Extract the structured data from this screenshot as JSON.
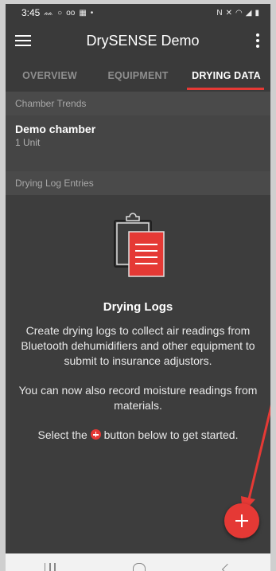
{
  "status_bar": {
    "time": "3:45",
    "left_icons": [
      "location-icon",
      "circle-icon",
      "voicemail-icon",
      "sim-icon",
      "dot-icon"
    ],
    "right_icons": [
      "nfc-icon",
      "mute-icon",
      "wifi-icon",
      "signal-icon",
      "battery-icon"
    ]
  },
  "app_bar": {
    "title": "DrySENSE Demo"
  },
  "tabs": [
    {
      "label": "OVERVIEW",
      "active": false
    },
    {
      "label": "EQUIPMENT",
      "active": false
    },
    {
      "label": "DRYING DATA",
      "active": true
    }
  ],
  "chamber_trends": {
    "header": "Chamber Trends",
    "chamber_name": "Demo chamber",
    "chamber_units": "1 Unit"
  },
  "drying_log": {
    "header": "Drying Log Entries",
    "empty_title": "Drying Logs",
    "empty_desc": "Create drying logs to collect air readings from Bluetooth dehumidifiers and other equipment to submit to insurance adjustors.",
    "empty_desc2": "You can now also record moisture readings from materials.",
    "select_prefix": "Select the",
    "select_suffix": "button below to get started."
  },
  "colors": {
    "accent": "#e53935",
    "toolbar": "#3a3a3a",
    "background": "#454545"
  }
}
